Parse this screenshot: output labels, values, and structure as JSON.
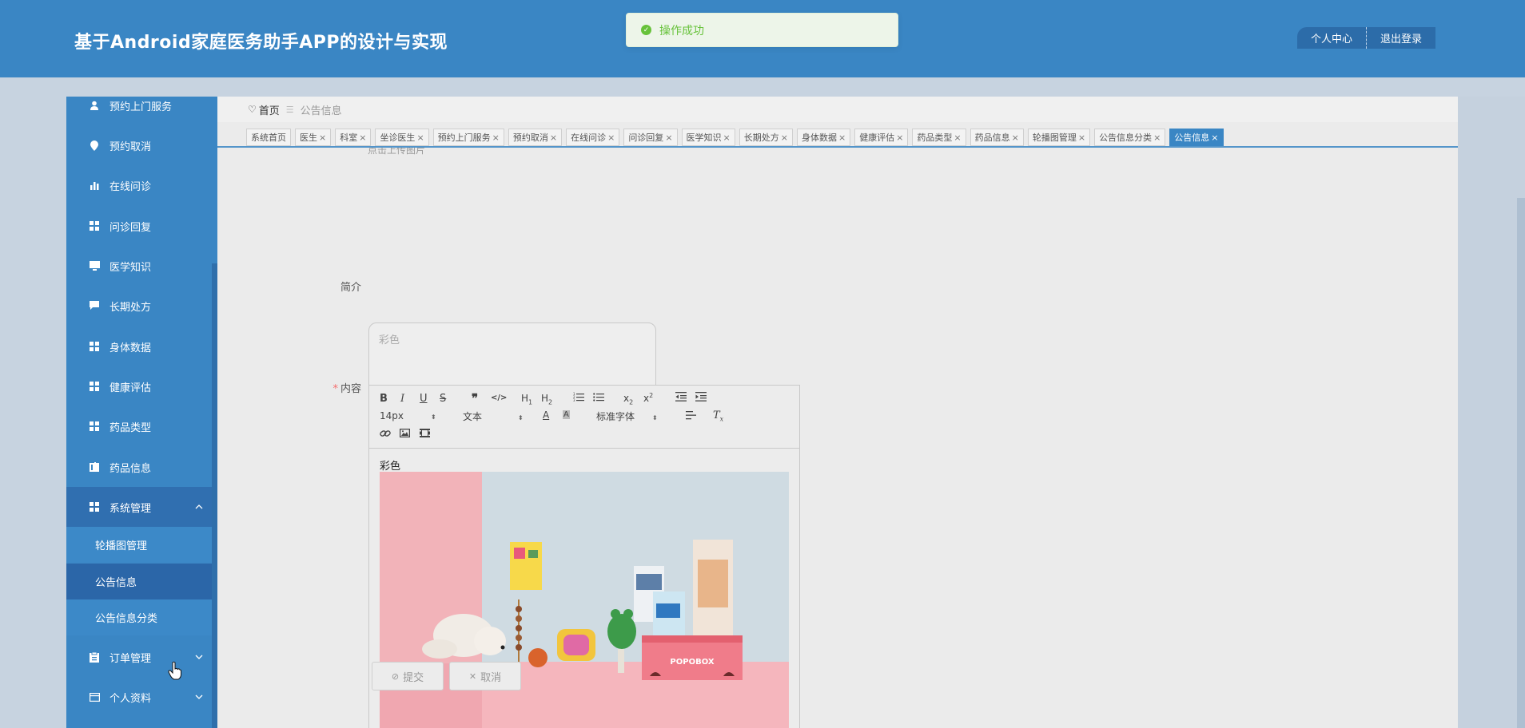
{
  "header": {
    "title": "基于Android家庭医务助手APP的设计与实现",
    "personal_center": "个人中心",
    "logout": "退出登录"
  },
  "toast": {
    "message": "操作成功",
    "type": "success"
  },
  "sidebar": {
    "items": [
      {
        "label": "预约上门服务",
        "icon": "person-icon"
      },
      {
        "label": "预约取消",
        "icon": "location-pin-icon"
      },
      {
        "label": "在线问诊",
        "icon": "bar-chart-icon"
      },
      {
        "label": "问诊回复",
        "icon": "grid-icon"
      },
      {
        "label": "医学知识",
        "icon": "monitor-icon"
      },
      {
        "label": "长期处方",
        "icon": "chat-bubble-icon"
      },
      {
        "label": "身体数据",
        "icon": "grid-icon"
      },
      {
        "label": "健康评估",
        "icon": "grid-icon"
      },
      {
        "label": "药品类型",
        "icon": "grid-icon"
      },
      {
        "label": "药品信息",
        "icon": "book-icon"
      }
    ],
    "system_group": {
      "label": "系统管理",
      "icon": "grid-icon",
      "sub_items": [
        "轮播图管理",
        "公告信息",
        "公告信息分类"
      ],
      "active_sub": "公告信息"
    },
    "order_group": {
      "label": "订单管理",
      "icon": "clipboard-icon"
    },
    "profile_group": {
      "label": "个人资料",
      "icon": "id-card-icon"
    }
  },
  "breadcrumb": {
    "home": "首页",
    "current": "公告信息"
  },
  "tabs": [
    "系统首页",
    "医生",
    "科室",
    "坐诊医生",
    "预约上门服务",
    "预约取消",
    "在线问诊",
    "问诊回复",
    "医学知识",
    "长期处方",
    "身体数据",
    "健康评估",
    "药品类型",
    "药品信息",
    "轮播图管理",
    "公告信息分类",
    "公告信息"
  ],
  "active_tab": "公告信息",
  "form": {
    "cut_label": "点击上传图片",
    "intro_label": "简介",
    "intro_value": "彩色",
    "content_label": "内容",
    "content_text": "彩色",
    "editor": {
      "font_size": "14px",
      "paragraph": "文本",
      "font_family": "标准字体"
    },
    "submit": "提交",
    "cancel": "取消"
  },
  "photo": {
    "box_text": "POPOBOX"
  },
  "colors": {
    "header_bg": "#3a86c4",
    "sidebar_active": "#2b66a8",
    "success": "#67c23a",
    "required": "#f56c6c"
  }
}
